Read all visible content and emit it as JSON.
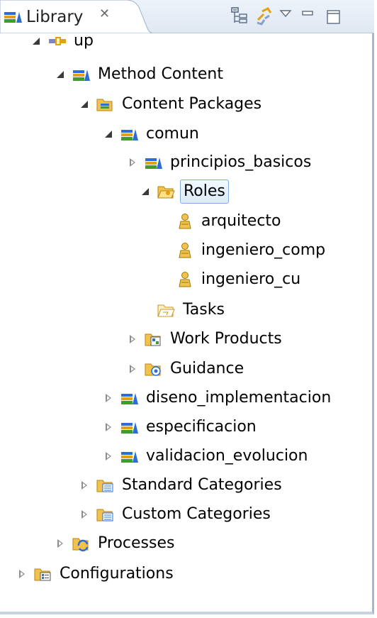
{
  "view": {
    "title": "Library",
    "close_glyph": "✕"
  },
  "toolbar": {
    "icons": [
      "collapse-all-icon",
      "link-with-editor-icon",
      "view-menu-icon",
      "minimize-icon",
      "maximize-icon"
    ]
  },
  "tree": [
    {
      "label": "up",
      "icon": "plugin-icon",
      "state": "open"
    },
    {
      "label": "Method Content",
      "icon": "method-library-icon",
      "state": "open"
    },
    {
      "label": "Content Packages",
      "icon": "content-packages-folder-icon",
      "state": "open"
    },
    {
      "label": "comun",
      "icon": "content-package-icon",
      "state": "open"
    },
    {
      "label": "principios_basicos",
      "icon": "content-package-icon",
      "state": "closed"
    },
    {
      "label": "Roles",
      "icon": "roles-folder-icon",
      "state": "open",
      "selected": true
    },
    {
      "label": "arquitecto",
      "icon": "role-icon",
      "state": "none"
    },
    {
      "label": "ingeniero_comp",
      "icon": "role-icon",
      "state": "none"
    },
    {
      "label": "ingeniero_cu",
      "icon": "role-icon",
      "state": "none"
    },
    {
      "label": "Tasks",
      "icon": "tasks-folder-icon",
      "state": "none"
    },
    {
      "label": "Work Products",
      "icon": "work-products-folder-icon",
      "state": "closed"
    },
    {
      "label": "Guidance",
      "icon": "guidance-folder-icon",
      "state": "closed"
    },
    {
      "label": "diseno_implementacion",
      "icon": "content-package-icon",
      "state": "closed"
    },
    {
      "label": "especificacion",
      "icon": "content-package-icon",
      "state": "closed"
    },
    {
      "label": "validacion_evolucion",
      "icon": "content-package-icon",
      "state": "closed"
    },
    {
      "label": "Standard Categories",
      "icon": "standard-categories-folder-icon",
      "state": "closed"
    },
    {
      "label": "Custom Categories",
      "icon": "custom-categories-folder-icon",
      "state": "closed"
    },
    {
      "label": "Processes",
      "icon": "processes-folder-icon",
      "state": "closed"
    },
    {
      "label": "Configurations",
      "icon": "configurations-folder-icon",
      "state": "closed"
    }
  ]
}
